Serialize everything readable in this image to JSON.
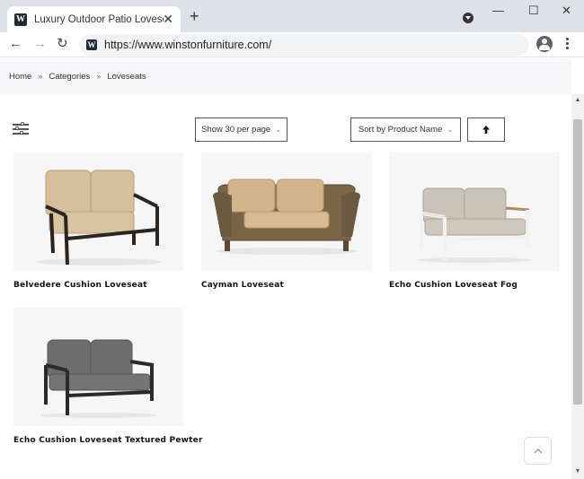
{
  "browser": {
    "tab_title": "Luxury Outdoor Patio Loveseats | W",
    "favicon_letter": "W",
    "tab_close": "✕",
    "new_tab": "+",
    "url": "https://www.winstonfurniture.com/",
    "back": "←",
    "forward": "→",
    "reload": "↻",
    "minimize": "—",
    "maximize": "☐",
    "close": "✕"
  },
  "breadcrumb": [
    {
      "label": "Home"
    },
    {
      "label": "Categories"
    },
    {
      "label": "Loveseats"
    }
  ],
  "breadcrumb_separator": "»",
  "controls": {
    "per_page_label": "Show 30 per page",
    "sort_label": "Sort by Product Name",
    "chevron": "⌄"
  },
  "products": [
    {
      "name": "Belvedere Cushion Loveseat",
      "frame_color": "#2c241e",
      "cushion_color": "#d6bf9c",
      "style": "metal"
    },
    {
      "name": "Cayman Loveseat",
      "frame_color": "#6b5a40",
      "cushion_color": "#d4b48d",
      "style": "wicker"
    },
    {
      "name": "Echo Cushion Loveseat Fog",
      "frame_color": "#eeeeee",
      "cushion_color": "#c9c3b8",
      "style": "metal-light"
    },
    {
      "name": "Echo Cushion Loveseat Textured Pewter",
      "frame_color": "#2a2a2a",
      "cushion_color": "#6e6e6e",
      "style": "metal"
    }
  ],
  "colors": {
    "chrome_bg": "#dee1e6",
    "breadcrumb_bg": "#f7f7f9",
    "border": "#555555"
  }
}
